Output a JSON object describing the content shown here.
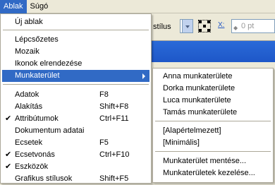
{
  "menubar": {
    "items": [
      "Ablak",
      "Súgó"
    ]
  },
  "toolbar": {
    "style_label": "stílus",
    "x_label": "X:",
    "pt_value": "0 pt"
  },
  "menu": {
    "new_window": "Új ablak",
    "cascade": "Lépcsőzetes",
    "tile": "Mozaik",
    "arrange_icons": "Ikonok elrendezése",
    "workspace": "Munkaterület",
    "items": [
      {
        "label": "Adatok",
        "shortcut": "F8",
        "checked": false
      },
      {
        "label": "Alakítás",
        "shortcut": "Shift+F8",
        "checked": false
      },
      {
        "label": "Attribútumok",
        "shortcut": "Ctrl+F11",
        "checked": true
      },
      {
        "label": "Dokumentum adatai",
        "shortcut": "",
        "checked": false
      },
      {
        "label": "Ecsetek",
        "shortcut": "F5",
        "checked": false
      },
      {
        "label": "Ecsetvonás",
        "shortcut": "Ctrl+F10",
        "checked": true
      },
      {
        "label": "Eszközök",
        "shortcut": "",
        "checked": true
      },
      {
        "label": "Grafikus stílusok",
        "shortcut": "Shift+F5",
        "checked": false
      }
    ],
    "check_glyph": "✔"
  },
  "submenu": {
    "workspaces": [
      "Anna munkaterülete",
      "Dorka munkaterülete",
      "Luca munkaterülete",
      "Tamás munkaterülete"
    ],
    "presets": [
      "[Alapértelmezett]",
      "[Minimális]"
    ],
    "actions": [
      "Munkaterület mentése...",
      "Munkaterületek kezelése..."
    ]
  },
  "colors": {
    "highlight": "#316ac5",
    "menubar": "#ece9d8",
    "titlebar": "#2a6ad8"
  }
}
